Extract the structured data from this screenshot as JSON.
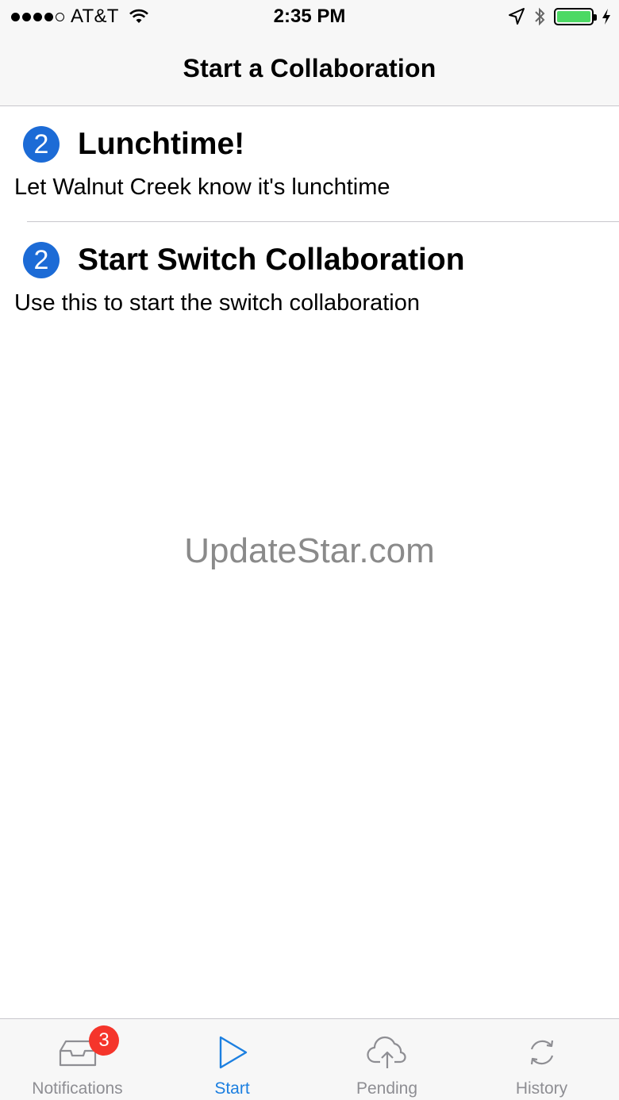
{
  "status_bar": {
    "carrier": "AT&T",
    "time": "2:35 PM",
    "battery_level": 1.0,
    "icons": [
      "signal-dots-icon",
      "wifi-icon",
      "location-arrow-icon",
      "bluetooth-icon",
      "battery-icon",
      "charging-bolt-icon"
    ]
  },
  "nav": {
    "title": "Start a Collaboration"
  },
  "list": {
    "items": [
      {
        "badge": "2",
        "title": "Lunchtime!",
        "subtitle": "Let Walnut Creek know it's lunchtime"
      },
      {
        "badge": "2",
        "title": "Start Switch Collaboration",
        "subtitle": "Use this to start the switch collaboration"
      }
    ]
  },
  "watermark": "UpdateStar.com",
  "tabs": [
    {
      "label": "Notifications",
      "icon": "inbox-tray-icon",
      "badge": "3",
      "active": false
    },
    {
      "label": "Start",
      "icon": "play-icon",
      "active": true
    },
    {
      "label": "Pending",
      "icon": "cloud-upload-icon",
      "active": false
    },
    {
      "label": "History",
      "icon": "refresh-icon",
      "active": false
    }
  ],
  "colors": {
    "accent": "#1c7fe0",
    "badge_blue": "#1c6bd6",
    "badge_red": "#f5352b",
    "battery_green": "#4cd964",
    "inactive_gray": "#8e8e93"
  }
}
